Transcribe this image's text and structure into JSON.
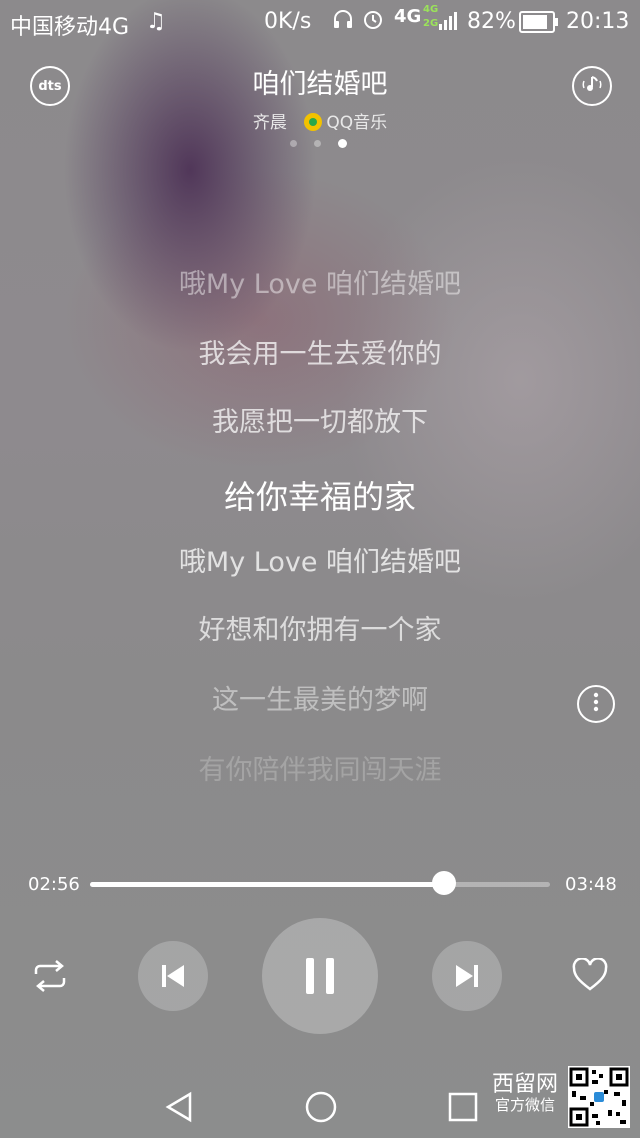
{
  "status_bar": {
    "carrier": "中国移动4G",
    "net_speed": "0K/s",
    "signal_label": "4G",
    "signal_sub_top": "4G",
    "signal_sub_bottom": "2G",
    "battery": "82%",
    "time": "20:13"
  },
  "header": {
    "song_title": "咱们结婚吧",
    "artist": "齐晨",
    "source": "QQ音乐",
    "left_button_label": "dts",
    "page_count": 3,
    "active_page": 3
  },
  "lyrics": [
    {
      "text": "哦My Love 咱们结婚吧",
      "state": "past-dim"
    },
    {
      "text": "我会用一生去爱你的",
      "state": "past"
    },
    {
      "text": "我愿把一切都放下",
      "state": "past"
    },
    {
      "text": "给你幸福的家",
      "state": "current"
    },
    {
      "text": "哦My Love 咱们结婚吧",
      "state": "next"
    },
    {
      "text": "好想和你拥有一个家",
      "state": "next"
    },
    {
      "text": "这一生最美的梦啊",
      "state": "fade"
    },
    {
      "text": "有你陪伴我同闯天涯",
      "state": "fade-more"
    }
  ],
  "player": {
    "elapsed": "02:56",
    "duration": "03:48",
    "progress_fraction": 0.77
  },
  "watermark": {
    "site": "西留网",
    "label": "官方微信"
  },
  "colors": {
    "accent": "#ffffff",
    "qq_yellow": "#f2c200",
    "qq_green": "#2aa84a"
  },
  "icons": [
    "music-note-icon",
    "headset-icon",
    "alarm-icon",
    "signal-icon",
    "battery-icon",
    "dts-icon",
    "sound-effect-icon",
    "more-icon",
    "repeat-icon",
    "previous-icon",
    "pause-icon",
    "next-icon",
    "heart-icon",
    "back-icon",
    "home-icon",
    "recents-icon",
    "qr-code-icon"
  ]
}
